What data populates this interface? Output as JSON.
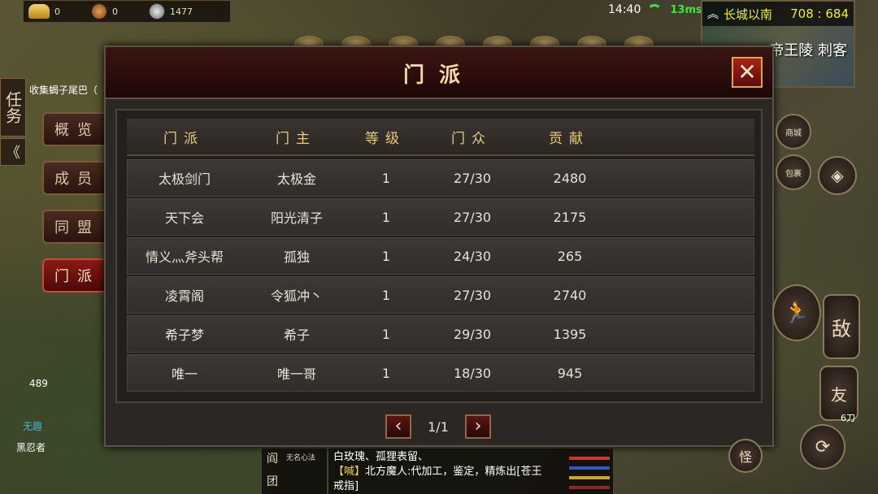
{
  "resources": {
    "gold": "0",
    "bronze": "0",
    "silver": "1477"
  },
  "status": {
    "time": "14:40",
    "ping": "13ms"
  },
  "minimap": {
    "location": "长城以南",
    "coords": "708 : 684",
    "overlay_text": "帝王陵 刺客"
  },
  "side": {
    "task": "任务",
    "collapse": "《",
    "quest_line1": "收集蝎子尾巴（"
  },
  "tabs": [
    "概览",
    "成员",
    "同盟",
    "门派"
  ],
  "dialog": {
    "title": "门派",
    "close": "✕",
    "headers": [
      "门派",
      "门主",
      "等级",
      "门众",
      "贡献"
    ],
    "rows": [
      [
        "太极剑门",
        "太极金",
        "1",
        "27/30",
        "2480"
      ],
      [
        "天下会",
        "阳光清子",
        "1",
        "27/30",
        "2175"
      ],
      [
        "情义灬斧头帮",
        "孤独",
        "1",
        "24/30",
        "265"
      ],
      [
        "凌霄阁",
        "令狐冲丶",
        "1",
        "27/30",
        "2740"
      ],
      [
        "希子梦",
        "希子",
        "1",
        "29/30",
        "1395"
      ],
      [
        "唯一",
        "唯一哥",
        "1",
        "18/30",
        "945"
      ]
    ],
    "page": "1/1",
    "prev": "‹",
    "next": "›"
  },
  "chat": {
    "left_tabs": [
      "阎",
      "团"
    ],
    "left_note": "无名心法",
    "line1": "白玫瑰、孤狸表留、",
    "tag": "【喊】",
    "speaker": "北方魔人",
    "message": ":代加工，鉴定，精炼出[苍王戒指]"
  },
  "right": {
    "enemy": "敌",
    "friend": "友",
    "side_label": "6刀",
    "monster": "怪",
    "label1": "商城",
    "label2": "包裹"
  },
  "player": {
    "hp": "489",
    "guild": "无趣",
    "name": "黑忍者"
  }
}
